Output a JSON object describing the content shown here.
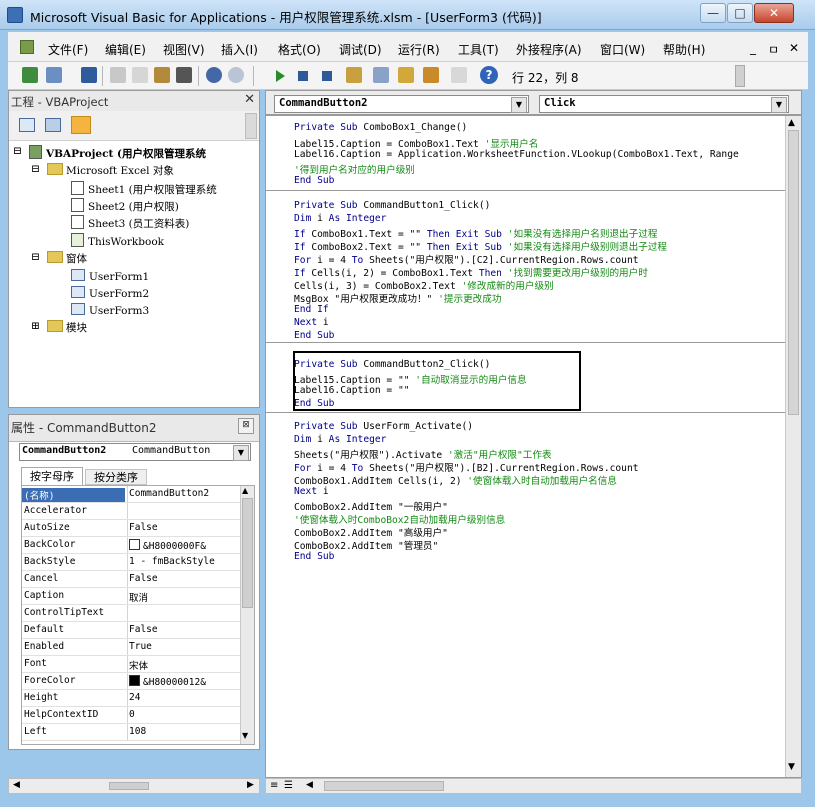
{
  "window": {
    "title": "Microsoft Visual Basic for Applications - 用户权限管理系统.xlsm - [UserForm3 (代码)]",
    "minimize": "—",
    "maximize": "□",
    "close": "✕"
  },
  "menu": {
    "items": [
      "文件(F)",
      "编辑(E)",
      "视图(V)",
      "插入(I)",
      "格式(O)",
      "调试(D)",
      "运行(R)",
      "工具(T)",
      "外接程序(A)",
      "窗口(W)",
      "帮助(H)"
    ],
    "mdi_buttons": [
      "_",
      "ㅁ",
      "✕"
    ]
  },
  "toolbar": {
    "position": "行 22，列 8",
    "help_icon": "?"
  },
  "project_pane": {
    "title": "工程 - VBAProject",
    "close": "✕",
    "tree": {
      "root": "VBAProject (用户权限管理系统",
      "excel_objects": "Microsoft Excel 对象",
      "sheets": [
        "Sheet1 (用户权限管理系统",
        "Sheet2 (用户权限)",
        "Sheet3 (员工资料表)"
      ],
      "workbook": "ThisWorkbook",
      "forms_folder": "窗体",
      "forms": [
        "UserForm1",
        "UserForm2",
        "UserForm3"
      ],
      "modules_folder": "模块"
    },
    "expanders": [
      "⊟",
      "⊟",
      "⊟",
      "⊞"
    ]
  },
  "properties_pane": {
    "title": "属性 - CommandButton2",
    "object_name": "CommandButton2",
    "object_type": "CommandButton",
    "tabs": [
      "按字母序",
      "按分类序"
    ],
    "rows": [
      {
        "name": "(名称)",
        "value": "CommandButton2",
        "selected": true
      },
      {
        "name": "Accelerator",
        "value": ""
      },
      {
        "name": "AutoSize",
        "value": "False"
      },
      {
        "name": "BackColor",
        "value": "&H8000000F&",
        "swatch": "#ffffff"
      },
      {
        "name": "BackStyle",
        "value": "1 - fmBackStyle"
      },
      {
        "name": "Cancel",
        "value": "False"
      },
      {
        "name": "Caption",
        "value": "取消"
      },
      {
        "name": "ControlTipText",
        "value": ""
      },
      {
        "name": "Default",
        "value": "False"
      },
      {
        "name": "Enabled",
        "value": "True"
      },
      {
        "name": "Font",
        "value": "宋体"
      },
      {
        "name": "ForeColor",
        "value": "&H80000012&",
        "swatch": "#000000"
      },
      {
        "name": "Height",
        "value": "24"
      },
      {
        "name": "HelpContextID",
        "value": "0"
      },
      {
        "name": "Left",
        "value": "108"
      }
    ]
  },
  "code_window": {
    "object_combo": "CommandButton2",
    "procedure_combo": "Click",
    "highlight_color": "#000000"
  },
  "code": {
    "lines": [
      [
        {
          "t": "Private Sub ",
          "c": "kw"
        },
        {
          "t": "ComboBox1_Change()",
          "c": ""
        }
      ],
      [
        {
          "t": "Label15.Caption = ComboBox1.Text ",
          "c": ""
        },
        {
          "t": "'显示用户名",
          "c": "cm"
        }
      ],
      [
        {
          "t": "Label16.Caption = Application.WorksheetFunction.VLookup(ComboBox1.Text, Range",
          "c": ""
        }
      ],
      [
        {
          "t": "  '得到用户名对应的用户级别",
          "c": "cm"
        }
      ],
      [
        {
          "t": "End Sub",
          "c": "kw"
        }
      ],
      [
        {
          "t": "Private Sub ",
          "c": "kw"
        },
        {
          "t": "CommandButton1_Click()",
          "c": ""
        }
      ],
      [
        {
          "t": "Dim ",
          "c": "kw"
        },
        {
          "t": "i ",
          "c": ""
        },
        {
          "t": "As Integer",
          "c": "kw"
        }
      ],
      [
        {
          "t": "If ",
          "c": "kw"
        },
        {
          "t": "ComboBox1.Text = \"\" ",
          "c": ""
        },
        {
          "t": "Then Exit Sub ",
          "c": "kw"
        },
        {
          "t": "'如果没有选择用户名则退出子过程",
          "c": "cm"
        }
      ],
      [
        {
          "t": "If ",
          "c": "kw"
        },
        {
          "t": "ComboBox2.Text = \"\" ",
          "c": ""
        },
        {
          "t": "Then Exit Sub ",
          "c": "kw"
        },
        {
          "t": "'如果没有选择用户级别则退出子过程",
          "c": "cm"
        }
      ],
      [
        {
          "t": "For ",
          "c": "kw"
        },
        {
          "t": "i = 4 ",
          "c": ""
        },
        {
          "t": "To ",
          "c": "kw"
        },
        {
          "t": "Sheets(\"用户权限\").[C2].CurrentRegion.Rows.count",
          "c": ""
        }
      ],
      [
        {
          "t": "    If ",
          "c": "kw"
        },
        {
          "t": "Cells(i, 2) = ComboBox1.Text ",
          "c": ""
        },
        {
          "t": "Then ",
          "c": "kw"
        },
        {
          "t": "'找到需要更改用户级别的用户时",
          "c": "cm"
        }
      ],
      [
        {
          "t": "      Cells(i, 3) = ComboBox2.Text ",
          "c": ""
        },
        {
          "t": "'修改成新的用户级别",
          "c": "cm"
        }
      ],
      [
        {
          "t": "      MsgBox \"用户权限更改成功！\" ",
          "c": ""
        },
        {
          "t": "'提示更改成功",
          "c": "cm"
        }
      ],
      [
        {
          "t": "    End If",
          "c": "kw"
        }
      ],
      [
        {
          "t": "Next ",
          "c": "kw"
        },
        {
          "t": "i",
          "c": ""
        }
      ],
      [
        {
          "t": "End Sub",
          "c": "kw"
        }
      ],
      [
        {
          "t": "Private Sub ",
          "c": "kw"
        },
        {
          "t": "CommandButton2_Click()",
          "c": ""
        }
      ],
      [
        {
          "t": "Label15.Caption = \"\" ",
          "c": ""
        },
        {
          "t": "'自动取消显示的用户信息",
          "c": "cm"
        }
      ],
      [
        {
          "t": "Label16.Caption = \"\"",
          "c": ""
        }
      ],
      [
        {
          "t": "End Sub",
          "c": "kw"
        }
      ],
      [
        {
          "t": "Private Sub ",
          "c": "kw"
        },
        {
          "t": "UserForm_Activate()",
          "c": ""
        }
      ],
      [
        {
          "t": "Dim ",
          "c": "kw"
        },
        {
          "t": "i ",
          "c": ""
        },
        {
          "t": "As Integer",
          "c": "kw"
        }
      ],
      [
        {
          "t": "Sheets(\"用户权限\").Activate ",
          "c": ""
        },
        {
          "t": "'激活\"用户权限\"工作表",
          "c": "cm"
        }
      ],
      [
        {
          "t": "For ",
          "c": "kw"
        },
        {
          "t": "i = 4 ",
          "c": ""
        },
        {
          "t": "To ",
          "c": "kw"
        },
        {
          "t": "Sheets(\"用户权限\").[B2].CurrentRegion.Rows.count",
          "c": ""
        }
      ],
      [
        {
          "t": "    ComboBox1.AddItem Cells(i, 2) ",
          "c": ""
        },
        {
          "t": "'使窗体载入时自动加载用户名信息",
          "c": "cm"
        }
      ],
      [
        {
          "t": "Next ",
          "c": "kw"
        },
        {
          "t": "i",
          "c": ""
        }
      ],
      [
        {
          "t": "ComboBox2.AddItem \"一般用户\"",
          "c": ""
        }
      ],
      [
        {
          "t": "  '使窗体载入时ComboBox2自动加载用户级别信息",
          "c": "cm"
        }
      ],
      [
        {
          "t": "ComboBox2.AddItem \"高级用户\"",
          "c": ""
        }
      ],
      [
        {
          "t": "ComboBox2.AddItem \"管理员\"",
          "c": ""
        }
      ],
      [
        {
          "t": "End Sub",
          "c": "kw"
        }
      ]
    ]
  }
}
